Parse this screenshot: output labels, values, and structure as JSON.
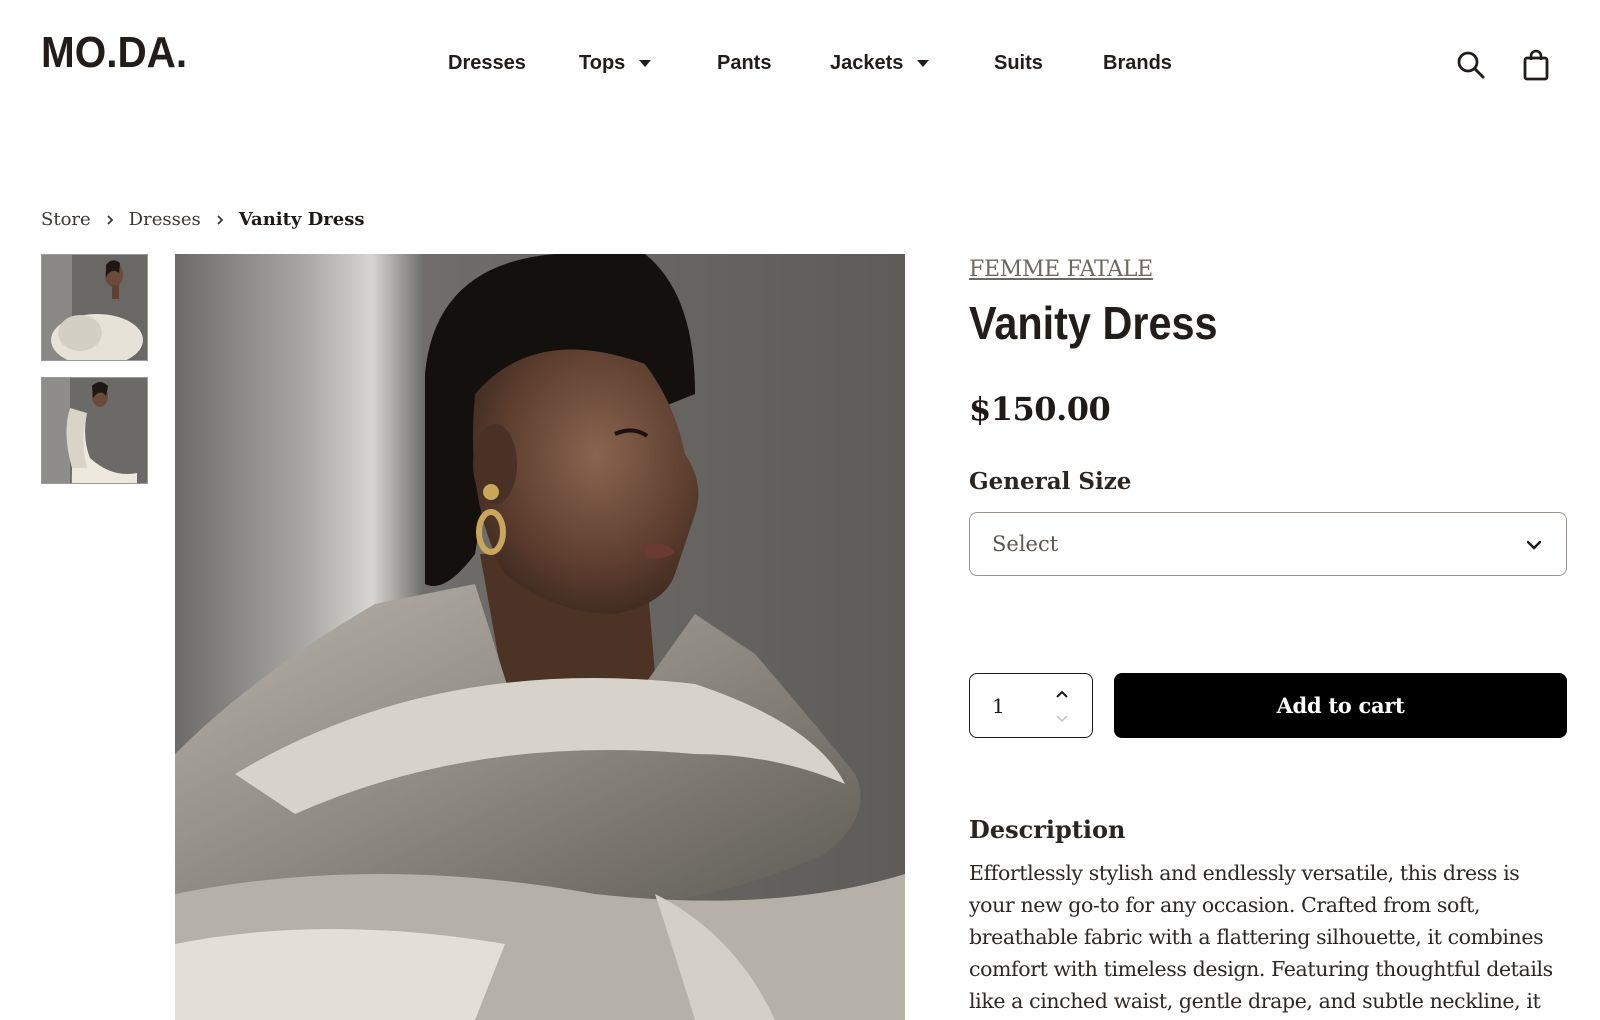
{
  "brand_logo": "MO.DA.",
  "nav": {
    "items": [
      {
        "label": "Dresses",
        "dropdown": false
      },
      {
        "label": "Tops",
        "dropdown": true
      },
      {
        "label": "Pants",
        "dropdown": false
      },
      {
        "label": "Jackets",
        "dropdown": true
      },
      {
        "label": "Suits",
        "dropdown": false
      },
      {
        "label": "Brands",
        "dropdown": false
      }
    ]
  },
  "header_icons": [
    "search-icon",
    "shopping-bag-icon"
  ],
  "breadcrumb": {
    "items": [
      "Store",
      "Dresses"
    ],
    "current": "Vanity Dress"
  },
  "gallery": {
    "thumbnails": [
      "thumbnail-front-view",
      "thumbnail-side-view"
    ]
  },
  "product": {
    "brand": "FEMME FATALE",
    "title": "Vanity Dress",
    "price": "$150.00",
    "size_label": "General Size",
    "size_placeholder": "Select",
    "quantity": "1",
    "add_to_cart_label": "Add to cart",
    "description_title": "Description",
    "description_text": "Effortlessly stylish and endlessly versatile, this dress is your new go-to for any occasion. Crafted from soft, breathable fabric with a flattering silhouette, it combines comfort with timeless design. Featuring thoughtful details like a cinched waist, gentle drape, and subtle neckline, it transitions"
  },
  "colors": {
    "text": "#1f1a17",
    "button_bg": "#000000",
    "button_text": "#ffffff",
    "brand_link": "#6e6862"
  }
}
